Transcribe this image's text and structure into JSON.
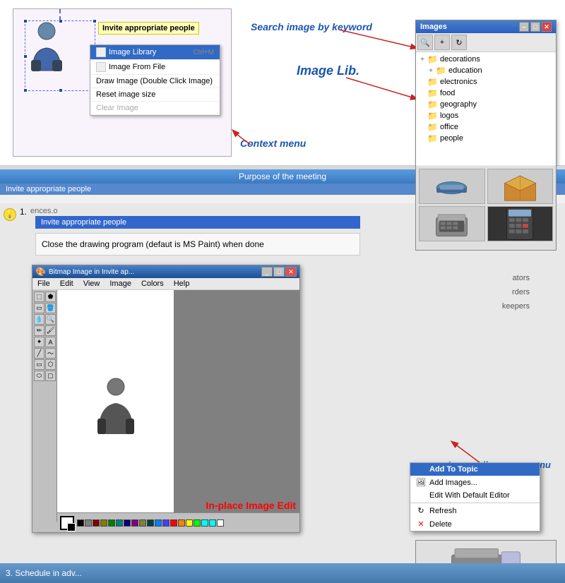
{
  "topArea": {
    "annotations": {
      "searchLabel": "Search image by keyword",
      "imageLibLabel": "Image Lib.",
      "contextMenuLabel": "Context menu"
    },
    "inviteLabel": "Invite appropriate people",
    "contextMenu": {
      "items": [
        {
          "label": "Image Library",
          "shortcut": "Ctrl+M",
          "icon": "img"
        },
        {
          "label": "Image From File",
          "shortcut": "",
          "icon": "img"
        },
        {
          "label": "Draw Image  (Double Click Image)",
          "shortcut": "",
          "icon": ""
        },
        {
          "label": "Reset image size",
          "shortcut": "",
          "icon": ""
        },
        {
          "label": "Clear Image",
          "shortcut": "",
          "icon": "",
          "disabled": true
        }
      ]
    }
  },
  "imagesPanel": {
    "title": "Images",
    "toolbar": [
      "search",
      "add",
      "refresh"
    ],
    "treeItems": [
      {
        "label": "decorations",
        "indent": 1,
        "expandable": true
      },
      {
        "label": "education",
        "indent": 2,
        "expandable": true
      },
      {
        "label": "electronics",
        "indent": 1,
        "expandable": false
      },
      {
        "label": "food",
        "indent": 1,
        "expandable": false
      },
      {
        "label": "geography",
        "indent": 1,
        "expandable": false
      },
      {
        "label": "logos",
        "indent": 1,
        "expandable": false
      },
      {
        "label": "office",
        "indent": 1,
        "expandable": false
      },
      {
        "label": "people",
        "indent": 1,
        "expandable": false
      }
    ]
  },
  "popupMenu": {
    "items": [
      {
        "label": "Add To Topic",
        "icon": "",
        "selected": true
      },
      {
        "label": "Add Images...",
        "icon": "img"
      },
      {
        "label": "Edit With Default Editor",
        "icon": ""
      },
      {
        "label": "Refresh",
        "icon": "refresh"
      },
      {
        "label": "Delete",
        "icon": "x"
      }
    ]
  },
  "mainWindow": {
    "title": "Purpose of the meeting",
    "slideTitle": "Invite appropriate people",
    "instructionText": "Close the drawing program (defaut is MS Paint) when done",
    "stepLabel": "3. Schedule in adv..."
  },
  "paintWindow": {
    "title": "Bitmap Image in Invite ap...",
    "menus": [
      "File",
      "Edit",
      "View",
      "Image",
      "Colors",
      "Help"
    ],
    "inPlaceLabel": "In-place Image Edit"
  },
  "annotations": {
    "imageLibPopupLabel": "Image Lib. popup menu"
  },
  "colors": {
    "accent": "#1a56b0",
    "red": "#cc0000",
    "blue": "#316ac5"
  }
}
